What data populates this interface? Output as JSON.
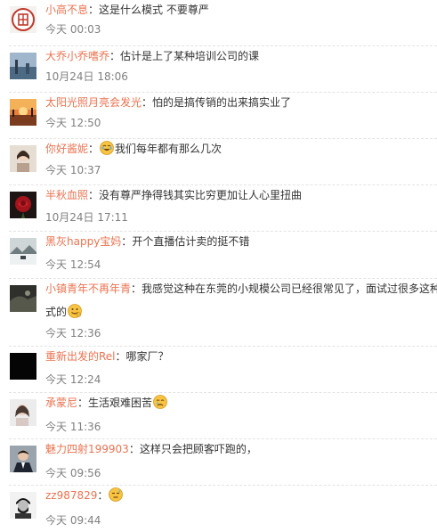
{
  "comments": [
    {
      "user": "小高不息",
      "text": "这是什么模式  不要尊严",
      "time": "今天 00:03",
      "avatar": "seal-avatar"
    },
    {
      "user": "大乔小乔嗜乔",
      "text": "估计是上了某种培训公司的课",
      "time": "10月24日 18:06",
      "avatar": "landscape-avatar"
    },
    {
      "user": "太阳光照月亮会发光",
      "text": "怕的是搞传销的出来搞实业了",
      "time": "今天 12:50",
      "avatar": "sunset-avatar"
    },
    {
      "user": "你好酱妮",
      "emoji": "laugh-cry-emoji",
      "text": "我们每年都有那么几次",
      "time": "今天 10:37",
      "avatar": "person-avatar"
    },
    {
      "user": "半秋血照",
      "text": "没有尊严挣得钱其实比穷更加让人心里扭曲",
      "time": "10月24日 17:11",
      "avatar": "rose-avatar"
    },
    {
      "user": "黑灰happy宝妈",
      "text": "开个直播估计卖的挺不错",
      "time": "今天 12:54",
      "avatar": "snow-avatar"
    },
    {
      "user": "小镇青年不再年青",
      "text": "我感觉这种在东莞的小规模公司已经很常见了，面试过很多这种",
      "text2": "式的",
      "emoji": "grin-emoji",
      "time": "今天 12:36",
      "avatar": "dark-avatar"
    },
    {
      "user": "重新出发的Rel",
      "text": "哪家厂？",
      "time": "今天 12:24",
      "avatar": "black-avatar"
    },
    {
      "user": "承蒙尼",
      "text": "生活艰难困苦",
      "emoji": "sad-emoji",
      "time": "今天 11:36",
      "avatar": "person2-avatar"
    },
    {
      "user": "魅力四射199903",
      "text": "这样只会把顾客吓跑的，",
      "time": "今天 09:56",
      "avatar": "suit-avatar"
    },
    {
      "user": "zz987829",
      "emoji": "sweat-emoji",
      "text": "",
      "time": "今天 09:44",
      "avatar": "portrait-avatar"
    }
  ],
  "colors": {
    "username": "#eb7350",
    "text": "#333333",
    "time": "#808080",
    "separator": "#e3e3e3"
  }
}
